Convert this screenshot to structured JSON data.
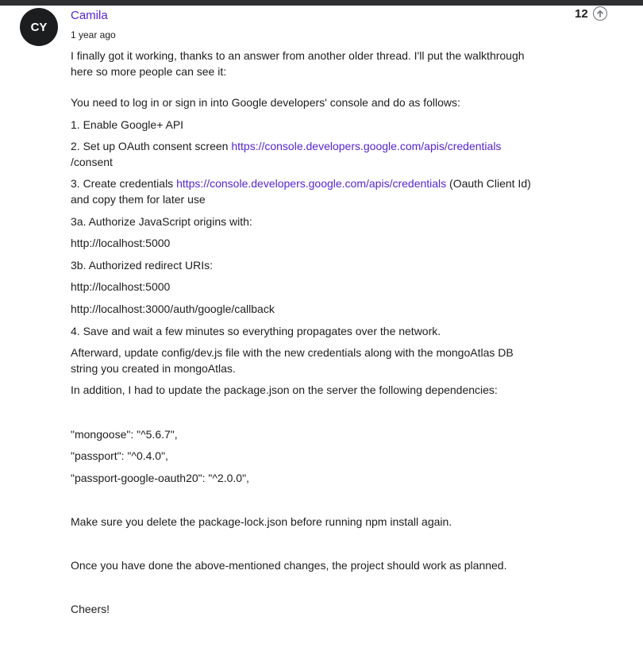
{
  "comment": {
    "avatar_initials": "CY",
    "author": "Camila",
    "time": "1 year ago",
    "votes": "12",
    "upvote_icon": "arrow-up-circle-icon",
    "intro": "I finally got it working, thanks to an answer from another older thread. I'll put the walkthrough here so more people can see it:",
    "step_intro": "You need to log in or sign in into Google developers' console and do as follows:",
    "step1": "1. Enable Google+ API",
    "step2_prefix": "2. Set up OAuth consent screen ",
    "step2_link": "https://console.developers.google.com/apis/credentials",
    "step2_suffix": "/consent",
    "step3_prefix": "3. Create credentials ",
    "step3_link": "https://console.developers.google.com/apis/credentials",
    "step3_suffix": " (Oauth Client Id) and copy them for later use",
    "step3a": "3a. Authorize JavaScript origins with:",
    "origin1": "http://localhost:5000",
    "step3b": "3b. Authorized redirect URIs:",
    "redirect1": "http://localhost:5000",
    "redirect2": "http://localhost:3000/auth/google/callback",
    "step4": "4. Save and wait a few minutes so everything propagates over the network.",
    "afterward": "Afterward,  update config/dev.js file with the new credentials along with the mongoAtlas DB string you created in mongoAtlas.",
    "in_addition": "In addition, I had to update the package.json on the server the following dependencies:",
    "dep1": "\"mongoose\": \"^5.6.7\",",
    "dep2": "\"passport\": \"^0.4.0\",",
    "dep3": "\"passport-google-oauth20\": \"^2.0.0\",",
    "make_sure": "Make sure you delete the package-lock.json before running npm install again.",
    "once": "Once you have done the above-mentioned changes, the project should work as planned.",
    "cheers": "Cheers!"
  },
  "colors": {
    "link": "#5624d0",
    "text": "#1c1d1f",
    "avatar_bg": "#1c1d1f",
    "topbar": "#2d2f31"
  }
}
